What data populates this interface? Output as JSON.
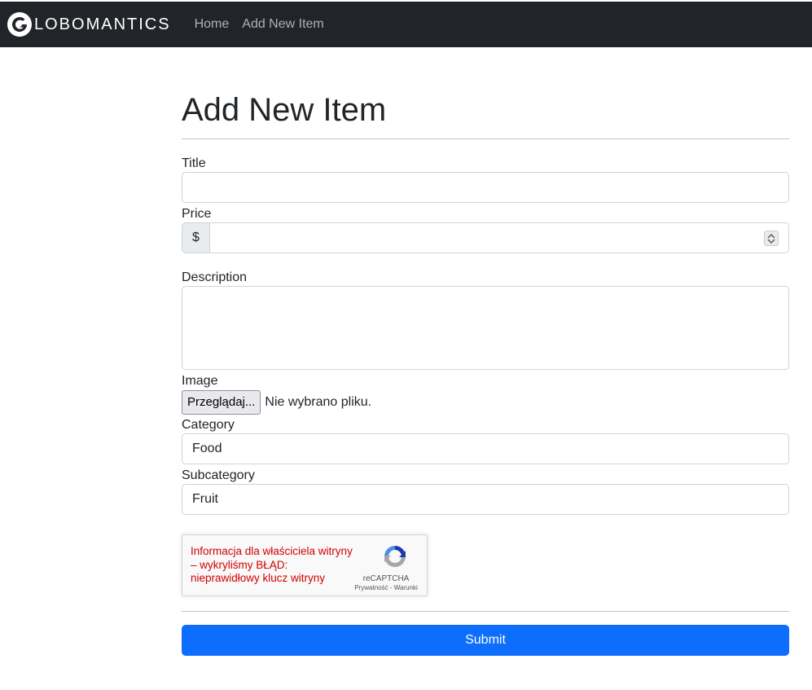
{
  "navbar": {
    "brand_text": "LOBOMANTICS",
    "links": [
      {
        "label": "Home"
      },
      {
        "label": "Add New Item"
      }
    ]
  },
  "page": {
    "title": "Add New Item"
  },
  "form": {
    "title_label": "Title",
    "title_value": "",
    "price_label": "Price",
    "price_prefix": "$",
    "price_value": "",
    "description_label": "Description",
    "description_value": "",
    "image_label": "Image",
    "file_button_label": "Przeglądaj...",
    "file_status": "Nie wybrano pliku.",
    "category_label": "Category",
    "category_value": "Food",
    "subcategory_label": "Subcategory",
    "subcategory_value": "Fruit",
    "submit_label": "Submit"
  },
  "recaptcha": {
    "error_text": "Informacja dla właściciela witryny – wykryliśmy BŁĄD: nieprawidłowy klucz witryny",
    "brand": "reCAPTCHA",
    "links": "Prywatność - Warunki"
  },
  "colors": {
    "navbar_bg": "#212529",
    "primary": "#0d6efd",
    "error_red": "#d20000"
  }
}
